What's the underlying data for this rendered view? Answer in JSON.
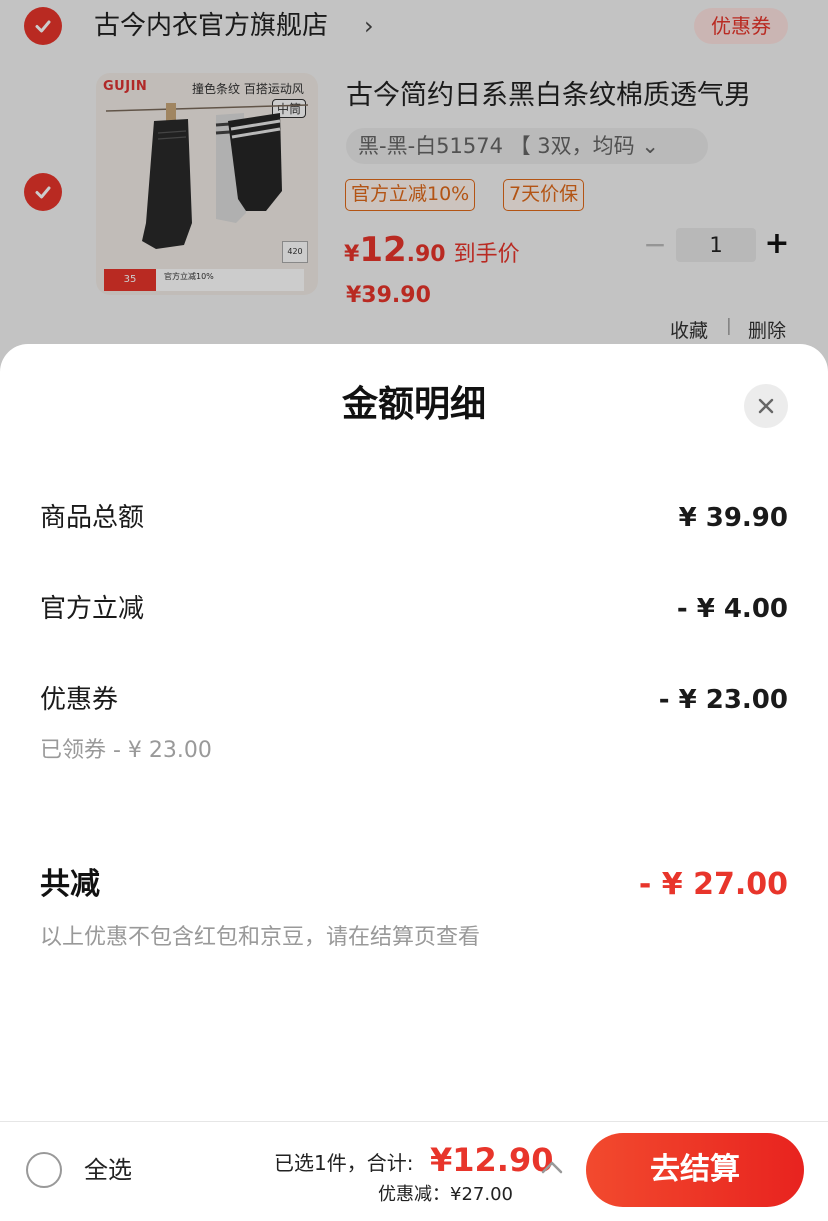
{
  "cart": {
    "store_name": "古今内衣官方旗舰店",
    "store_chevron": "›",
    "coupon_tag": "优惠券",
    "product": {
      "image": {
        "brand": "GUJIN",
        "tagline": "撞色条纹 百搭运动风",
        "chip": "中筒",
        "badge": "420",
        "price_pill": "35",
        "offer": "官方立减10%"
      },
      "title": "古今简约日系黑白条纹棉质透气男",
      "sku": "黑-黑-白51574 【 3双，均码 ⌄",
      "promo_tags": [
        "官方立减10%",
        "7天价保"
      ],
      "price_yen": "¥",
      "price_int": "12",
      "price_dec": ".90",
      "price_label": "到手价",
      "original_price": "¥39.90",
      "quantity": "1",
      "minus": "−",
      "plus": "+",
      "favorite": "收藏",
      "separator": "|",
      "delete": "删除"
    }
  },
  "sheet": {
    "title": "金额明细",
    "rows": [
      {
        "label": "商品总额",
        "value": "¥ 39.90"
      },
      {
        "label": "官方立减",
        "value": "- ¥ 4.00"
      },
      {
        "label": "优惠券",
        "value": "- ¥ 23.00",
        "sub": "已领券 - ¥ 23.00"
      }
    ],
    "total_label": "共减",
    "total_value": "- ¥ 27.00",
    "note": "以上优惠不包含红包和京豆，请在结算页查看"
  },
  "bottom": {
    "select_all": "全选",
    "summary_prefix": "已选1件，合计:",
    "summary_value": "¥12.90",
    "discount_line": "优惠减：¥27.00",
    "checkout": "去结算"
  },
  "colors": {
    "accent": "#e8352b",
    "promo": "#e06a1a"
  }
}
